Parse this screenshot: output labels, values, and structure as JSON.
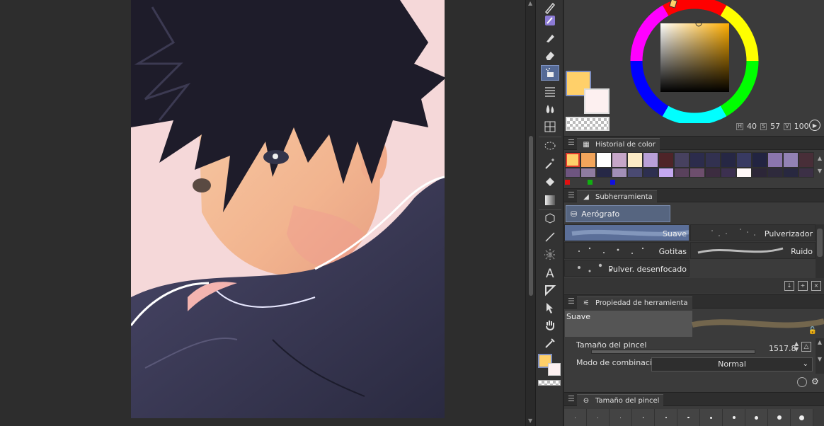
{
  "color_panel": {
    "main_color": "#ffd06a",
    "sub_color": "#fdf0f0",
    "hsv": {
      "h": "40",
      "s": "57",
      "v": "100"
    }
  },
  "panels": {
    "history_title": "Historial de color",
    "subtool_title": "Subherramienta",
    "property_title": "Propiedad de herramienta",
    "brushsize_title": "Tamaño del pincel"
  },
  "history_colors": {
    "row1": [
      "#ffd06a",
      "#f2a55b",
      "#ffffff",
      "#c6a6c8",
      "#fcebc6",
      "#b9a0d8",
      "#4e2428",
      "#47415f",
      "#2c2c4c",
      "#323150",
      "#262744",
      "#383a62",
      "#222441",
      "#8b76ae",
      "#9282b4",
      "#482e38"
    ],
    "row2": [
      "#6e5580",
      "#8f7ca0",
      "#262846",
      "#a28fb7",
      "#4a4a72",
      "#2d2f50",
      "#c4a8f0",
      "#59415c",
      "#6d4e6d",
      "#3c2c40",
      "#3c3050",
      "#fff8f8",
      "#2c2638",
      "#2e2a3c",
      "#282840",
      "#3c3046"
    ]
  },
  "subtool": {
    "group_label": "Aerógrafo",
    "brushes": [
      "Suave",
      "Pulverizador",
      "Gotitas",
      "Ruido",
      "Pulver. desenfocado"
    ]
  },
  "tool_property": {
    "preview_label": "Suave",
    "brush_size_label": "Tamaño del pincel",
    "brush_size_value": "1517.8",
    "blend_mode_label": "Modo de combinación",
    "blend_mode_value": "Normal"
  },
  "toolbar": {
    "icons": [
      "pen-icon",
      "marker-icon",
      "brush-icon",
      "eraser-icon",
      "airbrush-icon",
      "decoration-icon",
      "blend-icon",
      "grid-icon",
      "lasso-icon",
      "magic-wand-icon",
      "fill-icon",
      "gradient-icon",
      "3d-object-icon",
      "line-icon",
      "figure-icon",
      "text-icon",
      "ruler-icon",
      "operation-icon",
      "hand-icon",
      "eyedropper-icon"
    ]
  }
}
